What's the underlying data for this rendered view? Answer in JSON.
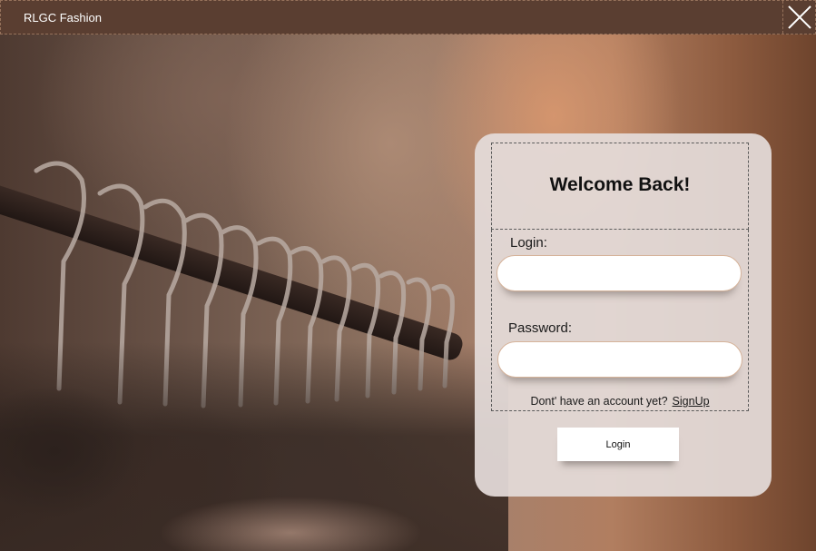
{
  "window": {
    "title": "RLGC Fashion",
    "close_icon": "close-icon"
  },
  "login_card": {
    "heading": "Welcome Back!",
    "login_label": "Login:",
    "login_value": "",
    "password_label": "Password:",
    "password_value": "",
    "signup_prompt": "Dont' have an account yet?",
    "signup_link": "SignUp",
    "login_button": "Login"
  },
  "colors": {
    "titlebar": "#5a3e31",
    "card": "#e4dcd9",
    "field_border": "#d6b39a"
  }
}
